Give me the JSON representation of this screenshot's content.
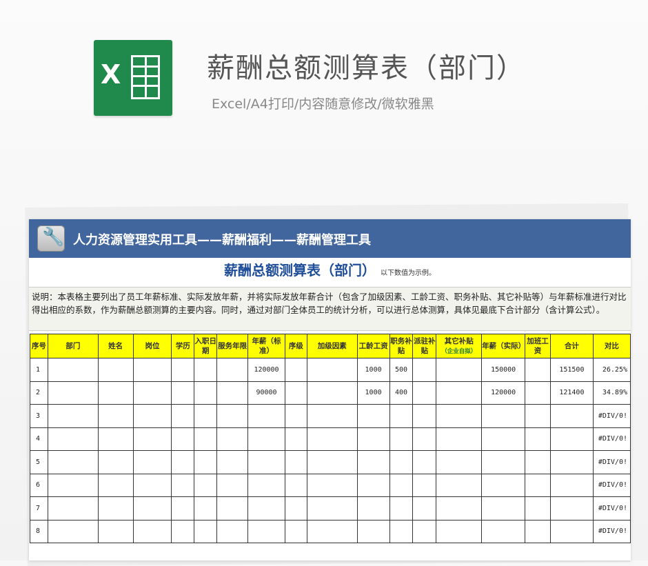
{
  "header": {
    "title": "薪酬总额测算表（部门）",
    "subtitle": "Excel/A4打印/内容随意修改/微软雅黑",
    "logo_letter": "X"
  },
  "sheet": {
    "banner": "人力资源管理实用工具——薪酬福利——薪酬管理工具",
    "title": "薪酬总额测算表（部门）",
    "title_note": "以下数值为示例。",
    "description": "说明：本表格主要列出了员工年薪标准、实际发放年薪，并将实际发放年薪合计（包含了加级因素、工龄工资、职务补贴、其它补贴等）与年薪标准进行对比得出相应的系数，作为薪酬总额测算的主要内容。同时，通过对部门全体员工的统计分析，可以进行总体测算，具体见最底下合计部分（含计算公式）。"
  },
  "table": {
    "headers": [
      {
        "label": "序号"
      },
      {
        "label": "部门"
      },
      {
        "label": "姓名"
      },
      {
        "label": "岗位"
      },
      {
        "label": "学历"
      },
      {
        "label": "入职日期"
      },
      {
        "label": "服务年限"
      },
      {
        "label": "年薪（标准）"
      },
      {
        "label": "序级"
      },
      {
        "label": "加级因素"
      },
      {
        "label": "工龄工资"
      },
      {
        "label": "职务补贴"
      },
      {
        "label": "派驻补贴"
      },
      {
        "label": "其它补贴",
        "note": "（企业自拟）"
      },
      {
        "label": "年薪（实际）"
      },
      {
        "label": "加班工资"
      },
      {
        "label": "合计"
      },
      {
        "label": "对比"
      }
    ],
    "rows": [
      [
        "1",
        "",
        "",
        "",
        "",
        "",
        "",
        "120000",
        "",
        "",
        "1000",
        "500",
        "",
        "",
        "150000",
        "",
        "151500",
        "26.25%"
      ],
      [
        "2",
        "",
        "",
        "",
        "",
        "",
        "",
        "90000",
        "",
        "",
        "1000",
        "400",
        "",
        "",
        "120000",
        "",
        "121400",
        "34.89%"
      ],
      [
        "3",
        "",
        "",
        "",
        "",
        "",
        "",
        "",
        "",
        "",
        "",
        "",
        "",
        "",
        "",
        "",
        "",
        "#DIV/0!"
      ],
      [
        "4",
        "",
        "",
        "",
        "",
        "",
        "",
        "",
        "",
        "",
        "",
        "",
        "",
        "",
        "",
        "",
        "",
        "#DIV/0!"
      ],
      [
        "5",
        "",
        "",
        "",
        "",
        "",
        "",
        "",
        "",
        "",
        "",
        "",
        "",
        "",
        "",
        "",
        "",
        "#DIV/0!"
      ],
      [
        "6",
        "",
        "",
        "",
        "",
        "",
        "",
        "",
        "",
        "",
        "",
        "",
        "",
        "",
        "",
        "",
        "",
        "#DIV/0!"
      ],
      [
        "7",
        "",
        "",
        "",
        "",
        "",
        "",
        "",
        "",
        "",
        "",
        "",
        "",
        "",
        "",
        "",
        "",
        "#DIV/0!"
      ],
      [
        "8",
        "",
        "",
        "",
        "",
        "",
        "",
        "",
        "",
        "",
        "",
        "",
        "",
        "",
        "",
        "",
        "",
        "#DIV/0!"
      ]
    ]
  },
  "colors": {
    "banner": "#41659d",
    "header_fill": "#ffff00",
    "title_blue": "#1f4e99",
    "excel_green": "#1f8a4c"
  }
}
